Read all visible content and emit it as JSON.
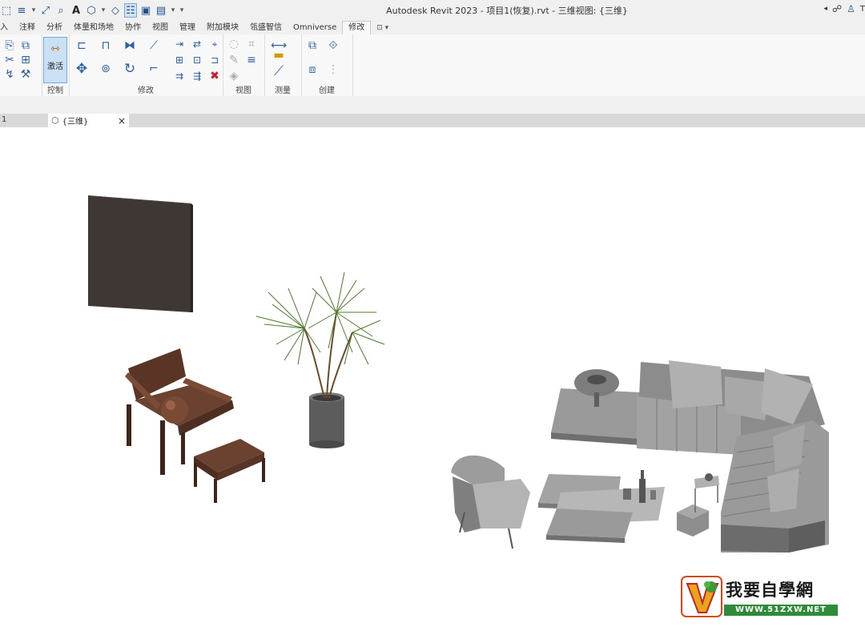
{
  "window": {
    "title": "Autodesk Revit 2023 - 项目1(恢复).rvt - 三维视图: {三维}"
  },
  "quick_access": {
    "text_tool": "A"
  },
  "title_right": {
    "user_initial": "T"
  },
  "ribbon_tabs": [
    {
      "label": "入"
    },
    {
      "label": "注释"
    },
    {
      "label": "分析"
    },
    {
      "label": "体量和场地"
    },
    {
      "label": "协作"
    },
    {
      "label": "视图"
    },
    {
      "label": "管理"
    },
    {
      "label": "附加模块"
    },
    {
      "label": "瓴盛智信"
    },
    {
      "label": "Omniverse"
    },
    {
      "label": "修改",
      "active": true
    }
  ],
  "ribbon": {
    "activate_label": "激活",
    "panels": {
      "control": "控制",
      "modify": "修改",
      "view": "视图",
      "measure": "测量",
      "create": "创建"
    }
  },
  "view_tabs": {
    "left_label": "1",
    "active_view": "{三维}",
    "close_symbol": "×"
  },
  "watermark": {
    "title": "我要自學網",
    "url": "WWW.51ZXW.NET"
  },
  "colors": {
    "ribbon_bg": "#f8f8f8",
    "accent_blue": "#2d5fa0",
    "selected_button": "#c9e0f5",
    "wood_brown": "#6b4230",
    "sofa_gray": "#8c8c8c",
    "plant_green": "#4f7a2a"
  }
}
